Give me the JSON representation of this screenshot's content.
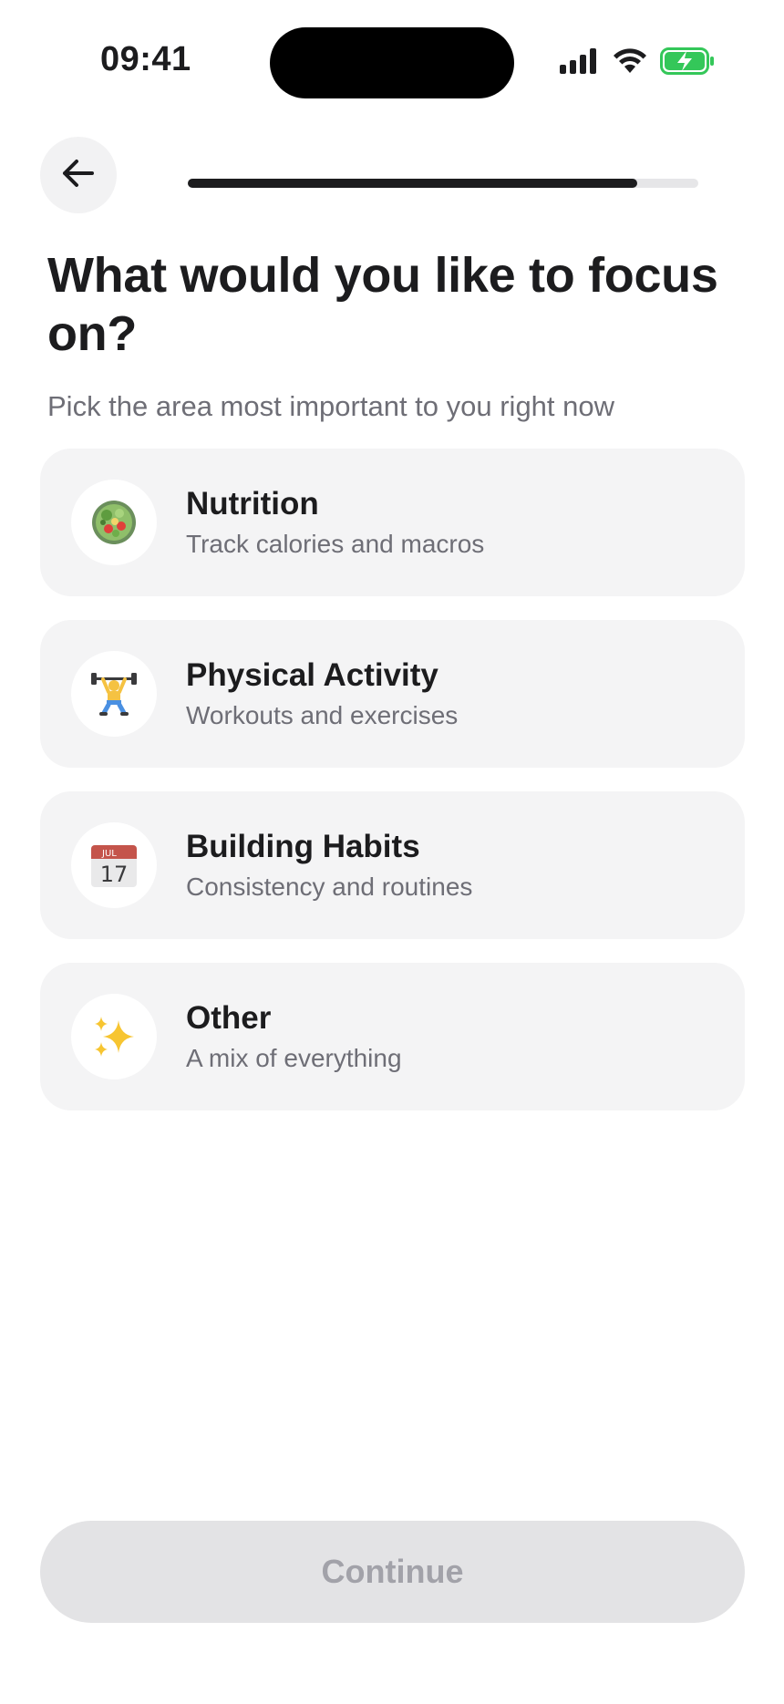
{
  "status_bar": {
    "time": "09:41",
    "icons": [
      "signal-icon",
      "wifi-icon",
      "battery-charging-icon"
    ],
    "battery_color": "#34c759"
  },
  "header": {
    "back_icon": "arrow-left-icon",
    "progress": 0.88
  },
  "title": "What would you like to focus on?",
  "subtitle": "Pick the area most important to you right now",
  "options": [
    {
      "icon": "salad-icon",
      "title": "Nutrition",
      "description": "Track calories and macros"
    },
    {
      "icon": "weightlifter-icon",
      "title": "Physical Activity",
      "description": "Workouts and exercises"
    },
    {
      "icon": "calendar-icon",
      "title": "Building Habits",
      "description": "Consistency and routines"
    },
    {
      "icon": "sparkles-icon",
      "title": "Other",
      "description": "A mix of everything"
    }
  ],
  "calendar_icon": {
    "month": "JUL",
    "day": "17"
  },
  "continue_label": "Continue",
  "colors": {
    "card_bg": "#f4f4f5",
    "disabled_button_bg": "#e3e3e5",
    "disabled_button_text": "#a2a2a9"
  }
}
